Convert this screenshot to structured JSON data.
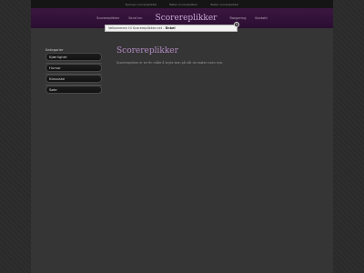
{
  "topbar": {
    "links": [
      "Fjernsyn scorereplikker",
      "Bøker scorereplikker",
      "Teater scorereplikker"
    ]
  },
  "navbar": {
    "left_links": [
      "Scorereplikker",
      "Send inn"
    ],
    "brand": "Scorereplikker",
    "right_links": [
      "Rangering",
      "Kontakt"
    ]
  },
  "cookie_notice": {
    "message": "Velkommen til Scorereplikker.net - ",
    "accept_label": "Enkel",
    "close_icon": "close-icon",
    "close_glyph": "×"
  },
  "sidebar": {
    "title": "Kategorier",
    "items": [
      "Kjærlighet",
      "Humor",
      "Klassiske",
      "Søte"
    ]
  },
  "main": {
    "title": "Scorereplikker",
    "text": "Scorereplikker er en fin måte å bryte isen på når du møter noen nye."
  },
  "colors": {
    "background": "#2b2b2b",
    "nav_purple": "#3a1740",
    "title_purple": "#b48bc4"
  }
}
